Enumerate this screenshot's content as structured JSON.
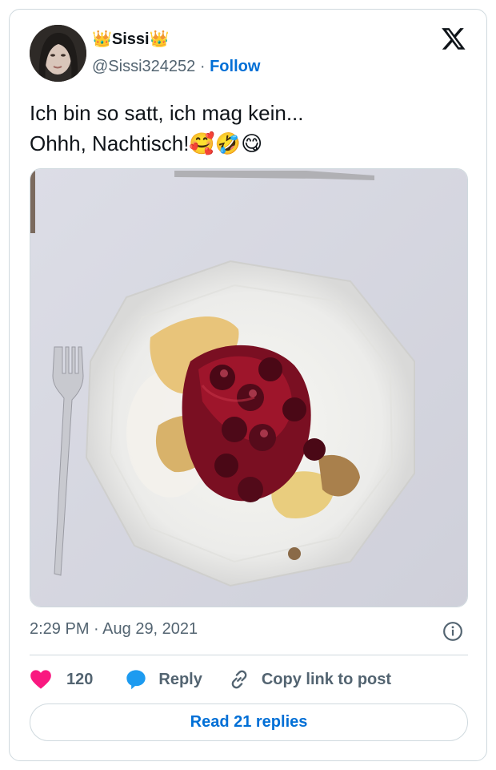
{
  "user": {
    "display_name": "👑Sissi👑",
    "handle": "@Sissi324252",
    "separator": "·",
    "follow_label": "Follow"
  },
  "tweet": {
    "text_line1": "Ich bin so satt, ich mag kein...",
    "text_line2": "Ohhh, Nachtisch!🥰🤣😋",
    "media_alt": "Dessert plate with cherries and Kaiserschmarrn"
  },
  "meta": {
    "time": "2:29 PM",
    "separator": "·",
    "date": "Aug 29, 2021"
  },
  "actions": {
    "like_count": "120",
    "reply_label": "Reply",
    "copy_label": "Copy link to post"
  },
  "footer": {
    "read_replies_label": "Read 21 replies"
  },
  "colors": {
    "like": "#f91880",
    "reply": "#1d9bf0",
    "link": "#006fd6",
    "muted": "#536471",
    "border": "#cfd9de"
  },
  "icons": [
    "x-logo-icon",
    "info-icon",
    "heart-icon",
    "speech-bubble-icon",
    "link-icon"
  ]
}
